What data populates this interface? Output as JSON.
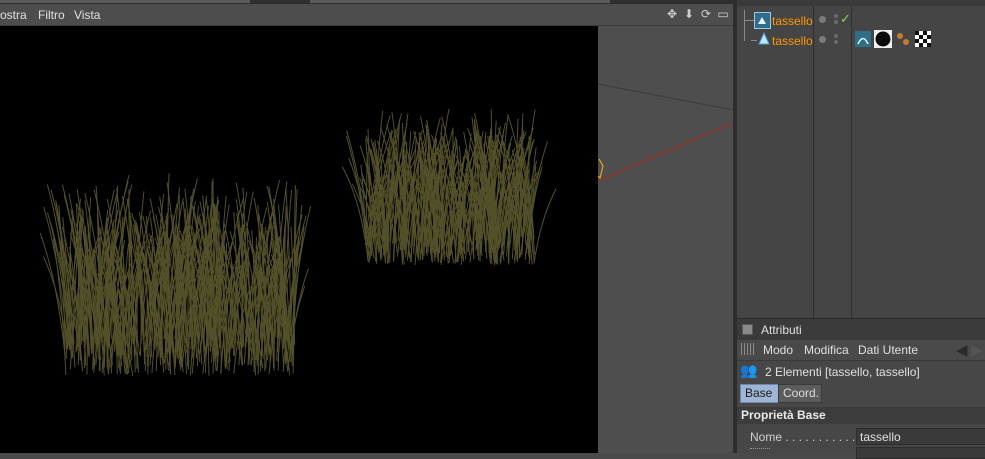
{
  "viewport": {
    "menu": [
      "ostra",
      "Filtro",
      "Vista"
    ],
    "nav_icons": [
      "move-icon",
      "move-down-icon",
      "rotate-icon",
      "maximize-icon"
    ]
  },
  "objects": [
    {
      "name": "tassello",
      "icon": "generator-icon",
      "enabled_check": "✓"
    },
    {
      "name": "tassello",
      "icon": "cone-icon",
      "tags": [
        "hair-tag-icon",
        "material-black-icon",
        "material-dots-icon",
        "checker-tag-icon"
      ]
    }
  ],
  "attributes": {
    "title": "Attributi",
    "menu": [
      "Modo",
      "Modifica",
      "Dati Utente"
    ],
    "selection": "2 Elementi [tassello, tassello]",
    "tabs": [
      "Base",
      "Coord."
    ],
    "section": "Proprietà Base",
    "fields": [
      {
        "label": "Nome . . . . . . . . . . . .",
        "value": "tassello"
      }
    ]
  },
  "colors": {
    "accent_orange": "#ff9900",
    "check_green": "#7fdc5a",
    "active_tab": "#9fb5d6"
  }
}
